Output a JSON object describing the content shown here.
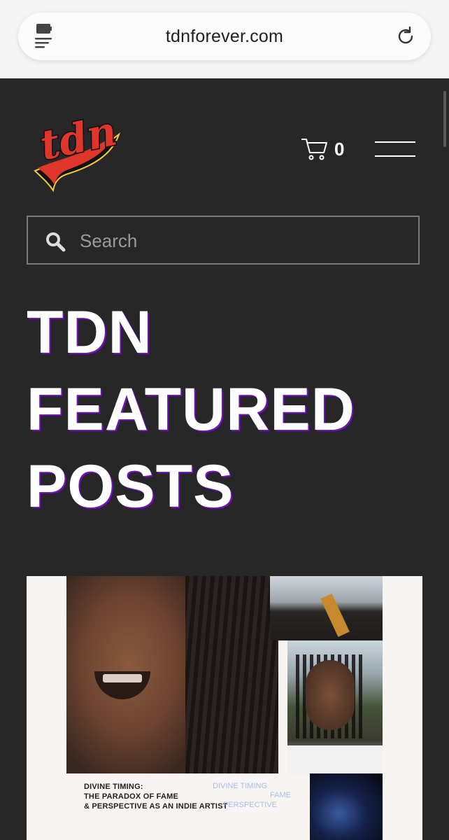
{
  "browser": {
    "url": "tdnforever.com"
  },
  "header": {
    "logo_text": "tdn",
    "cart_count": "0"
  },
  "search": {
    "placeholder": "Search"
  },
  "main": {
    "title_lines": [
      "TDN",
      "FEATURED",
      "POSTS"
    ]
  },
  "featured_post": {
    "title_lines": [
      "DIVINE TIMING:",
      "THE PARADOX OF FAME",
      "& PERSPECTIVE AS AN INDIE ARTIST"
    ],
    "tags": [
      "DIVINE TIMING",
      "FAME",
      "PERSPECTIVE"
    ]
  },
  "colors": {
    "page_background": "#272727",
    "title_text": "#ffffff",
    "title_shadow": "#6a1aa5",
    "logo_red": "#e0352b",
    "logo_yellow": "#f2c744",
    "tag_text": "#a9bde3"
  },
  "icons": {
    "reader": "reader-mode-icon",
    "reload": "reload-icon",
    "cart": "shopping-cart-icon",
    "menu": "hamburger-menu-icon",
    "search": "magnifier-search-icon"
  }
}
